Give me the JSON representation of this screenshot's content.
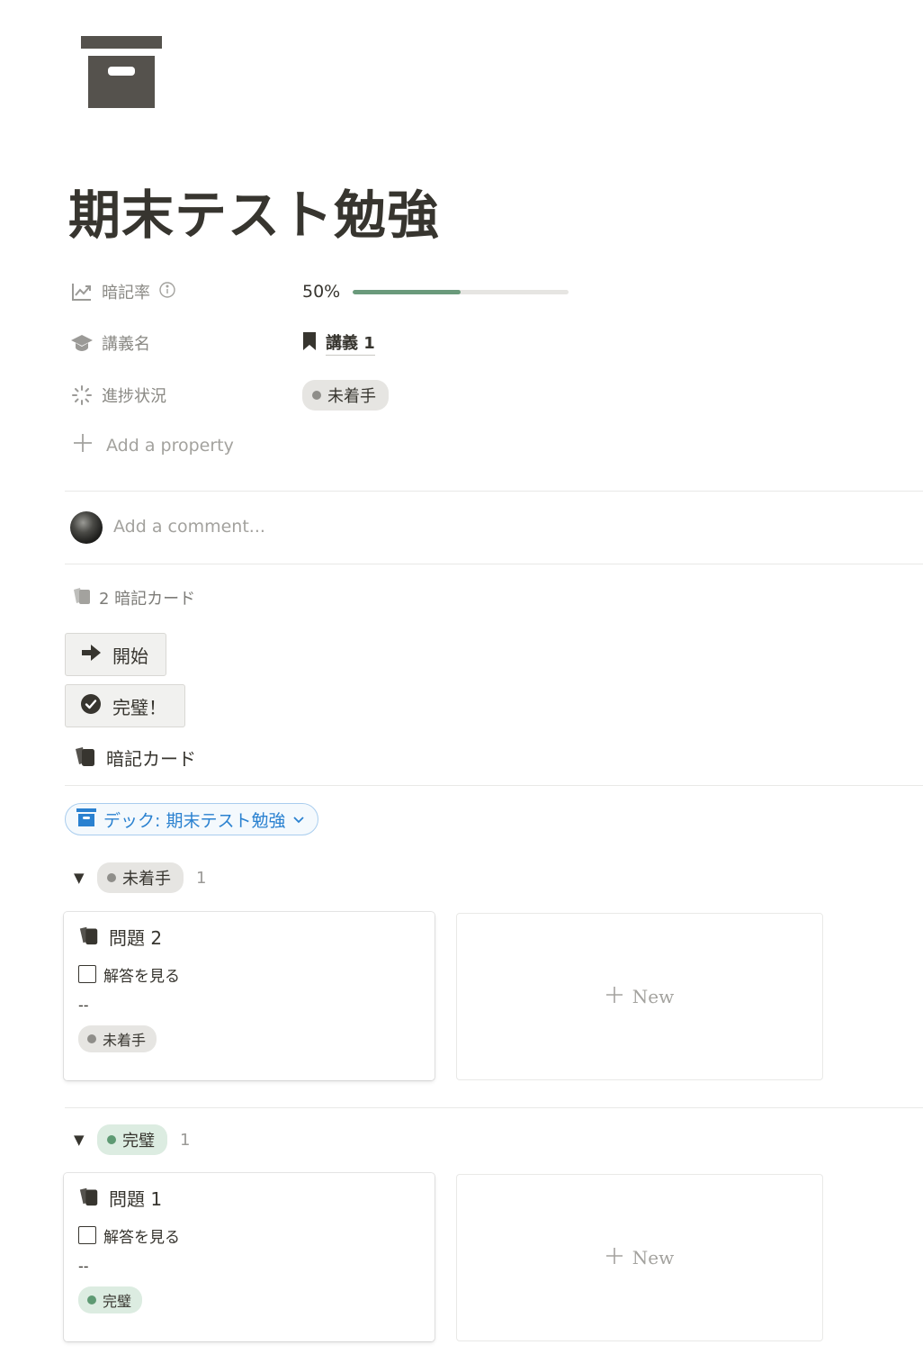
{
  "page": {
    "title": "期末テスト勉強",
    "icon": "archive-box-icon"
  },
  "properties": {
    "recall_rate": {
      "label": "暗記率",
      "value_text": "50%",
      "value": 0.5,
      "icon": "trend-chart-icon",
      "info_icon": "info-icon"
    },
    "lecture": {
      "label": "講義名",
      "value": "講義 1",
      "icon": "graduation-cap-icon",
      "value_icon": "bookmark-icon"
    },
    "status": {
      "label": "進捗状況",
      "value": "未着手",
      "icon": "loading-spinner-icon"
    },
    "add_property": "Add a property"
  },
  "comment": {
    "placeholder": "Add a comment..."
  },
  "backlinks": {
    "text": "2 暗記カード",
    "icon": "cards-icon"
  },
  "buttons": {
    "start": {
      "label": "開始",
      "icon": "arrow-right-icon"
    },
    "done": {
      "label": "完璧！",
      "icon": "check-circle-icon"
    }
  },
  "database": {
    "title": "暗記カード",
    "filter_chip": "デック: 期末テスト勉強",
    "groups": [
      {
        "status": "未着手",
        "count": "1",
        "card": {
          "title": "問題 2",
          "checkbox_label": "解答を見る",
          "empty": "--",
          "status": "未着手"
        },
        "new_label": "New"
      },
      {
        "status": "完璧",
        "count": "1",
        "card": {
          "title": "問題 1",
          "checkbox_label": "解答を見る",
          "empty": "--",
          "status": "完璧"
        },
        "new_label": "New"
      }
    ]
  },
  "colors": {
    "text": "#37352f",
    "muted": "#8a8984",
    "progress": "#6a9a7b",
    "status_gray": "#e6e5e2",
    "status_green": "#dcece1",
    "link_blue": "#2a81d0"
  }
}
